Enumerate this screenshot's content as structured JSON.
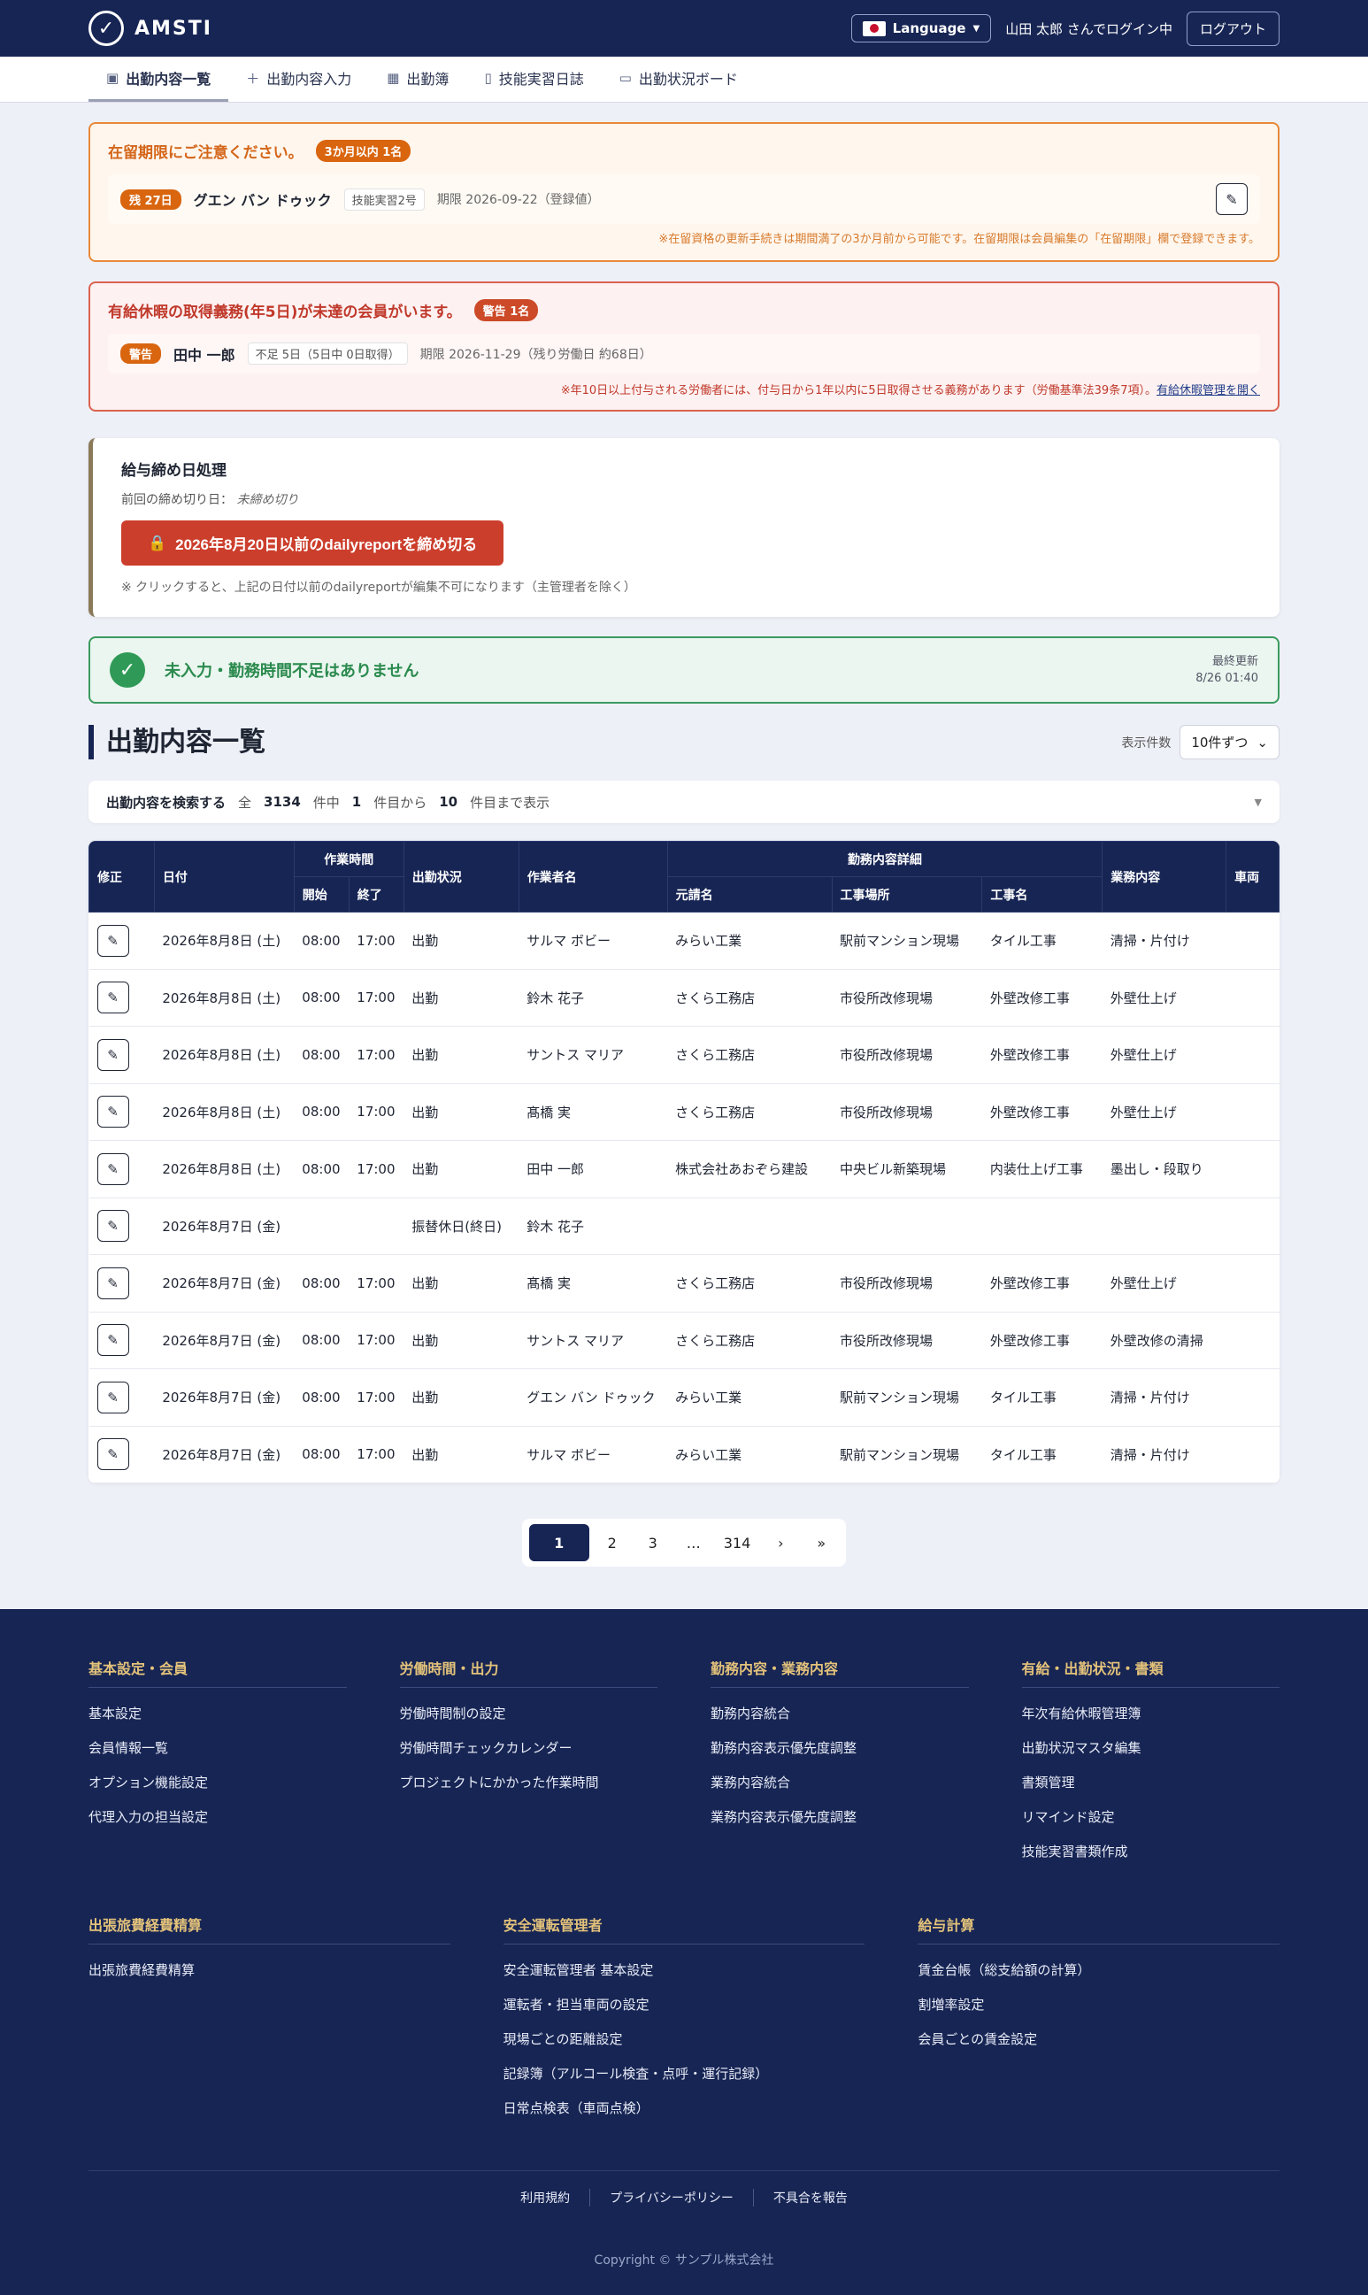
{
  "header": {
    "brand": "AMSTI",
    "language": "Language",
    "login_text": "山田 太郎 さんでログイン中",
    "logout": "ログアウト"
  },
  "tabs": [
    {
      "label": "出勤内容一覧",
      "icon": "calendar-icon"
    },
    {
      "label": "出勤内容入力",
      "icon": "plus-icon"
    },
    {
      "label": "出勤簿",
      "icon": "table-icon"
    },
    {
      "label": "技能実習日誌",
      "icon": "document-icon"
    },
    {
      "label": "出勤状況ボード",
      "icon": "chat-icon"
    }
  ],
  "visa_alert": {
    "title": "在留期限にご注意ください。",
    "badge": "3か月以内 1名",
    "days": "残 27日",
    "name": "グエン バン ドゥック",
    "type": "技能実習2号",
    "due": "期限 2026-09-22（登録値）",
    "note": "※在留資格の更新手続きは期間満了の3か月前から可能です。在留期限は会員編集の「在留期限」欄で登録できます。"
  },
  "leave_alert": {
    "title": "有給休暇の取得義務(年5日)が未達の会員がいます。",
    "badge": "警告 1名",
    "tag": "警告",
    "name": "田中 一郎",
    "shortage": "不足 5日（5日中 0日取得）",
    "due": "期限 2026-11-29（残り労働日 約68日）",
    "note": "※年10日以上付与される労働者には、付与日から1年以内に5日取得させる義務があります（労働基準法39条7項）。",
    "link": "有給休暇管理を開く"
  },
  "payroll": {
    "title": "給与締め日処理",
    "last_label": "前回の締め切り日：",
    "last_value": "未締め切り",
    "button": "2026年8月20日以前のdailyreportを締め切る",
    "note": "※ クリックすると、上記の日付以前のdailyreportが編集不可になります（主管理者を除く）"
  },
  "ok_banner": {
    "text": "未入力・勤務時間不足はありません",
    "updated_label": "最終更新",
    "updated_value": "8/26 01:40"
  },
  "list": {
    "title": "出勤内容一覧",
    "perpage_label": "表示件数",
    "perpage_value": "10件ずつ"
  },
  "search": {
    "label": "出勤内容を検索する",
    "all": "全",
    "total": "3134",
    "middle": "件中",
    "from": "1",
    "from_suffix": "件目から",
    "to": "10",
    "to_suffix": "件目まで表示"
  },
  "table": {
    "h_edit": "修正",
    "h_date": "日付",
    "h_worktime": "作業時間",
    "h_start": "開始",
    "h_end": "終了",
    "h_status": "出勤状況",
    "h_worker": "作業者名",
    "h_detail": "勤務内容詳細",
    "h_contractor": "元請名",
    "h_site": "工事場所",
    "h_work": "工事名",
    "h_task": "業務内容",
    "h_vehicle": "車両",
    "rows": [
      {
        "date": "2026年8月8日 (土)",
        "start": "08:00",
        "end": "17:00",
        "status": "出勤",
        "worker": "サルマ ボビー",
        "contractor": "みらい工業",
        "site": "駅前マンション現場",
        "work": "タイル工事",
        "task": "清掃・片付け"
      },
      {
        "date": "2026年8月8日 (土)",
        "start": "08:00",
        "end": "17:00",
        "status": "出勤",
        "worker": "鈴木 花子",
        "contractor": "さくら工務店",
        "site": "市役所改修現場",
        "work": "外壁改修工事",
        "task": "外壁仕上げ"
      },
      {
        "date": "2026年8月8日 (土)",
        "start": "08:00",
        "end": "17:00",
        "status": "出勤",
        "worker": "サントス マリア",
        "contractor": "さくら工務店",
        "site": "市役所改修現場",
        "work": "外壁改修工事",
        "task": "外壁仕上げ"
      },
      {
        "date": "2026年8月8日 (土)",
        "start": "08:00",
        "end": "17:00",
        "status": "出勤",
        "worker": "髙橋 実",
        "contractor": "さくら工務店",
        "site": "市役所改修現場",
        "work": "外壁改修工事",
        "task": "外壁仕上げ"
      },
      {
        "date": "2026年8月8日 (土)",
        "start": "08:00",
        "end": "17:00",
        "status": "出勤",
        "worker": "田中 一郎",
        "contractor": "株式会社あおぞら建設",
        "site": "中央ビル新築現場",
        "work": "内装仕上げ工事",
        "task": "墨出し・段取り"
      },
      {
        "date": "2026年8月7日 (金)",
        "start": "",
        "end": "",
        "status": "振替休日(終日)",
        "worker": "鈴木 花子",
        "contractor": "",
        "site": "",
        "work": "",
        "task": ""
      },
      {
        "date": "2026年8月7日 (金)",
        "start": "08:00",
        "end": "17:00",
        "status": "出勤",
        "worker": "髙橋 実",
        "contractor": "さくら工務店",
        "site": "市役所改修現場",
        "work": "外壁改修工事",
        "task": "外壁仕上げ"
      },
      {
        "date": "2026年8月7日 (金)",
        "start": "08:00",
        "end": "17:00",
        "status": "出勤",
        "worker": "サントス マリア",
        "contractor": "さくら工務店",
        "site": "市役所改修現場",
        "work": "外壁改修工事",
        "task": "外壁改修の清掃"
      },
      {
        "date": "2026年8月7日 (金)",
        "start": "08:00",
        "end": "17:00",
        "status": "出勤",
        "worker": "グエン バン ドゥック",
        "contractor": "みらい工業",
        "site": "駅前マンション現場",
        "work": "タイル工事",
        "task": "清掃・片付け"
      },
      {
        "date": "2026年8月7日 (金)",
        "start": "08:00",
        "end": "17:00",
        "status": "出勤",
        "worker": "サルマ ボビー",
        "contractor": "みらい工業",
        "site": "駅前マンション現場",
        "work": "タイル工事",
        "task": "清掃・片付け"
      }
    ]
  },
  "pagination": [
    "1",
    "2",
    "3",
    "…",
    "314",
    "›",
    "»"
  ],
  "footer": {
    "cols4": [
      {
        "title": "基本設定・会員",
        "links": [
          "基本設定",
          "会員情報一覧",
          "オプション機能設定",
          "代理入力の担当設定"
        ]
      },
      {
        "title": "労働時間・出力",
        "links": [
          "労働時間制の設定",
          "労働時間チェックカレンダー",
          "プロジェクトにかかった作業時間"
        ]
      },
      {
        "title": "勤務内容・業務内容",
        "links": [
          "勤務内容統合",
          "勤務内容表示優先度調整",
          "業務内容統合",
          "業務内容表示優先度調整"
        ]
      },
      {
        "title": "有給・出勤状況・書類",
        "links": [
          "年次有給休暇管理簿",
          "出勤状況マスタ編集",
          "書類管理",
          "リマインド設定",
          "技能実習書類作成"
        ]
      }
    ],
    "cols3": [
      {
        "title": "出張旅費経費精算",
        "links": [
          "出張旅費経費精算"
        ]
      },
      {
        "title": "安全運転管理者",
        "links": [
          "安全運転管理者 基本設定",
          "運転者・担当車両の設定",
          "現場ごとの距離設定",
          "記録簿（アルコール検査・点呼・運行記録）",
          "日常点検表（車両点検）"
        ]
      },
      {
        "title": "給与計算",
        "links": [
          "賃金台帳（総支給額の計算）",
          "割増率設定",
          "会員ごとの賃金設定"
        ]
      }
    ],
    "bottom_links": [
      "利用規約",
      "プライバシーポリシー",
      "不具合を報告"
    ],
    "copyright": "Copyright © サンプル株式会社"
  }
}
